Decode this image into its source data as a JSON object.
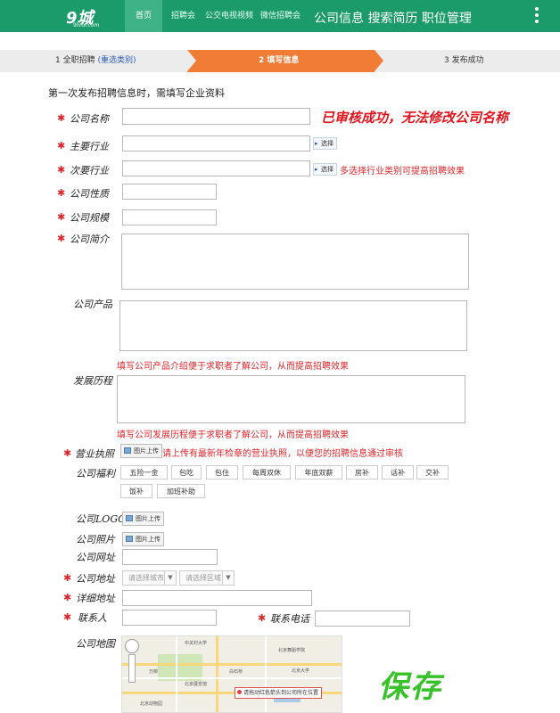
{
  "brand": {
    "logo": "9城",
    "sub": "9linx.com"
  },
  "nav": {
    "items": [
      "首页",
      "招聘会",
      "公交电视视频",
      "微信招聘会"
    ],
    "title": "公司信息 搜索简历 职位管理"
  },
  "steps": {
    "s1": "1 全职招聘",
    "s1_link": "(重选类别)",
    "s2": "2 填写信息",
    "s3": "3 发布成功"
  },
  "intro": "第一次发布招聘信息时，需填写企业资料",
  "form": {
    "company_name": "公司名称",
    "company_name_note": "已审核成功，无法修改公司名称",
    "primary_industry": "主要行业",
    "secondary_industry": "次要行业",
    "select_button": "选择",
    "industry_hint": "多选择行业类别可提高招聘效果",
    "nature": "公司性质",
    "scale": "公司规模",
    "intro": "公司简介",
    "products": "公司产品",
    "products_hint": "填写公司产品介绍便于求职者了解公司，从而提高招聘效果",
    "history": "发展历程",
    "history_hint": "填写公司发展历程便于求职者了解公司，从而提高招聘效果",
    "license": "营业执照",
    "upload_button": "图片上传",
    "license_hint": "请上传有最新年检章的营业执照，以便您的招聘信息通过审核",
    "welfare": "公司福利",
    "welfare_tags": [
      "五险一金",
      "包吃",
      "包住",
      "每周双休",
      "年底双薪",
      "房补",
      "话补",
      "交补",
      "饭补",
      "加班补助"
    ],
    "logo": "公司LOGO",
    "photo": "公司照片",
    "website": "公司网址",
    "address": "公司地址",
    "city_placeholder": "请选择城市",
    "district_placeholder": "请选择区域",
    "detail_address": "详细地址",
    "contact": "联系人",
    "phone": "联系电话",
    "map": "公司地图",
    "save": "保存"
  },
  "map": {
    "popup": "请拖动红色箭头到公司所在位置",
    "labels": [
      "中关村大学",
      "北京舞蹈学院",
      "北京大学",
      "万柳",
      "白石桥",
      "北京展览馆",
      "北京动物园"
    ]
  },
  "colors": {
    "nav_bg": "#1b9a6a",
    "step_active": "#f07c36",
    "required": "#d9262b",
    "save": "#38c22a"
  }
}
